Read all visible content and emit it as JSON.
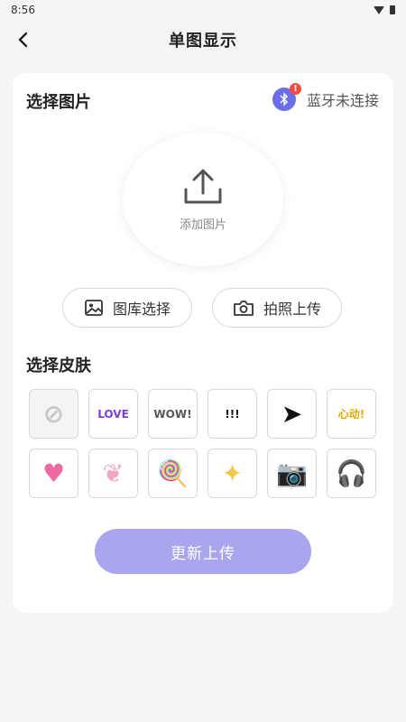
{
  "status_bar": {
    "time": "8:56"
  },
  "nav": {
    "title": "单图显示"
  },
  "select_image": {
    "title": "选择图片",
    "bluetooth_status": "蓝牙未连接",
    "bt_icon": "bluetooth-icon",
    "bt_badge": "!",
    "upload_label": "添加图片",
    "gallery_button": "图库选择",
    "camera_button": "拍照上传"
  },
  "skins": {
    "title": "选择皮肤",
    "items": [
      {
        "name": "none",
        "glyph": "⊘",
        "color": "#c8c8c8"
      },
      {
        "name": "love",
        "glyph": "LOVE",
        "color": "#7a3fd6"
      },
      {
        "name": "wow",
        "glyph": "WOW!",
        "color": "#555555"
      },
      {
        "name": "burst",
        "glyph": "!!!",
        "color": "#111111"
      },
      {
        "name": "cursor",
        "glyph": "➤",
        "color": "#111111"
      },
      {
        "name": "crown",
        "glyph": "心动!",
        "color": "#e0a800"
      },
      {
        "name": "heart-bubble",
        "glyph": "♥",
        "color": "#ee6aa0"
      },
      {
        "name": "butterfly",
        "glyph": "❦",
        "color": "#f1a6c4"
      },
      {
        "name": "lollipop",
        "glyph": "🍭",
        "color": "#f08ab8"
      },
      {
        "name": "sparkle",
        "glyph": "✦",
        "color": "#f2c94c"
      },
      {
        "name": "camera",
        "glyph": "📷",
        "color": "#f08aa0"
      },
      {
        "name": "headphones",
        "glyph": "🎧",
        "color": "#7a6fd6"
      }
    ]
  },
  "submit": {
    "label": "更新上传"
  },
  "colors": {
    "accent": "#a9a5ee",
    "bluetooth": "#6a6ee8",
    "badge": "#f04b3c"
  }
}
